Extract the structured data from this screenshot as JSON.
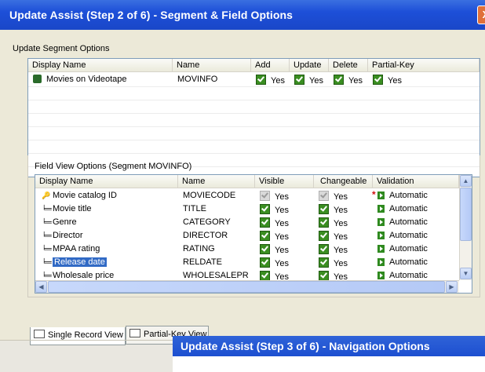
{
  "window": {
    "title": "Update Assist (Step 2 of 6) - Segment & Field Options",
    "close_glyph": "X"
  },
  "segment_options": {
    "label": "Update Segment Options",
    "columns": [
      "Display Name",
      "Name",
      "Add",
      "Update",
      "Delete",
      "Partial-Key"
    ],
    "rows": [
      {
        "display_name": "Movies on Videotape",
        "name": "MOVINFO",
        "add": "Yes",
        "update": "Yes",
        "delete": "Yes",
        "partial_key": "Yes"
      }
    ]
  },
  "field_options": {
    "label": "Field View Options (Segment MOVINFO)",
    "columns": [
      "Display Name",
      "Name",
      "Visible",
      "Changeable",
      "Validation"
    ],
    "rows": [
      {
        "display_name": "Movie catalog ID",
        "name": "MOVIECODE",
        "visible": "Yes",
        "changeable": "Yes",
        "validation": "Automatic"
      },
      {
        "display_name": "Movie title",
        "name": "TITLE",
        "visible": "Yes",
        "changeable": "Yes",
        "validation": "Automatic"
      },
      {
        "display_name": "Genre",
        "name": "CATEGORY",
        "visible": "Yes",
        "changeable": "Yes",
        "validation": "Automatic"
      },
      {
        "display_name": "Director",
        "name": "DIRECTOR",
        "visible": "Yes",
        "changeable": "Yes",
        "validation": "Automatic"
      },
      {
        "display_name": "MPAA rating",
        "name": "RATING",
        "visible": "Yes",
        "changeable": "Yes",
        "validation": "Automatic"
      },
      {
        "display_name": "Release date",
        "name": "RELDATE",
        "visible": "Yes",
        "changeable": "Yes",
        "validation": "Automatic"
      },
      {
        "display_name": "Wholesale price",
        "name": "WHOLESALEPR",
        "visible": "Yes",
        "changeable": "Yes",
        "validation": "Automatic"
      }
    ]
  },
  "tabs": {
    "single": "Single Record View",
    "partial": "Partial-Key View"
  },
  "next_window": {
    "title": "Update Assist (Step 3 of 6) - Navigation Options"
  },
  "colors": {
    "titlebar": "#1d4fd8",
    "check": "#3a8e21",
    "selection": "#316ac5"
  }
}
